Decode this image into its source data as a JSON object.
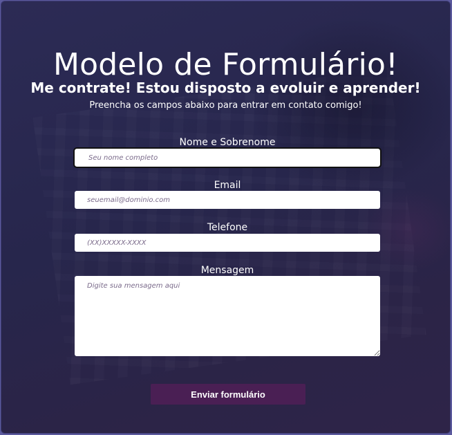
{
  "page": {
    "title": "Modelo de Formulário!",
    "subtitle": "Me contrate! Estou disposto a evoluir e aprender!",
    "lead": "Preencha os campos abaixo para entrar em contato comigo!"
  },
  "form": {
    "name": {
      "label": "Nome e Sobrenome",
      "placeholder": "Seu nome completo",
      "value": ""
    },
    "email": {
      "label": "Email",
      "placeholder": "seuemail@dominio.com",
      "value": ""
    },
    "phone": {
      "label": "Telefone",
      "placeholder": "(XX)XXXXX-XXXX",
      "value": ""
    },
    "message": {
      "label": "Mensagem",
      "placeholder": "Digite sua mensagem aqui",
      "value": ""
    },
    "submit_label": "Enviar formulário"
  },
  "colors": {
    "background": "#2a2950",
    "button": "#4a1f54",
    "text": "#ffffff"
  }
}
